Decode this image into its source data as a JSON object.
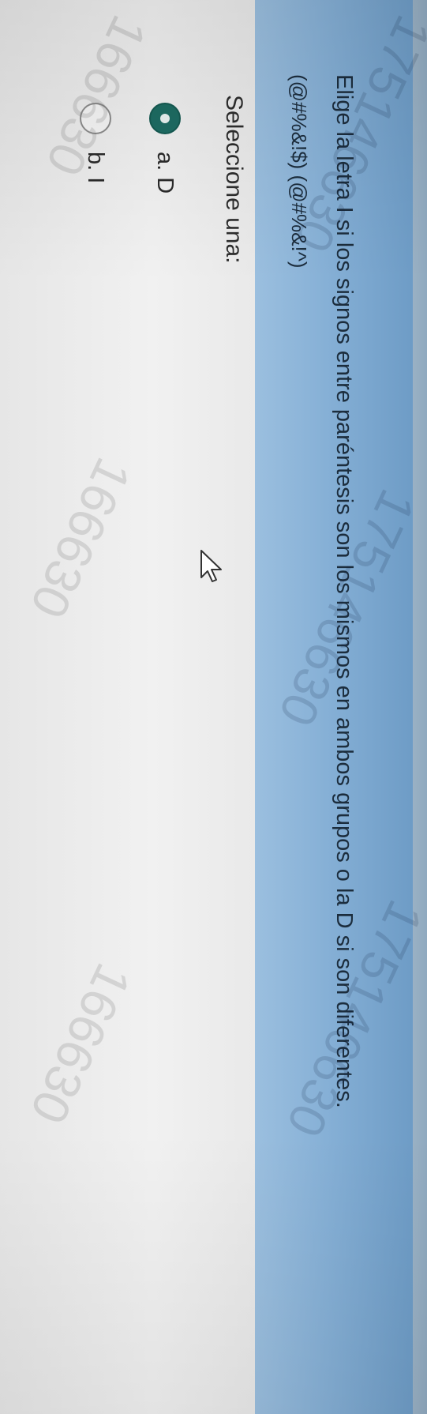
{
  "question": {
    "text": "Elige la letra I si los signos entre paréntesis son los mismos en ambos grupos o la D si son diferentes.",
    "codes": "(@#%&!$) (@#%&!^)"
  },
  "answer": {
    "prompt": "Seleccione una:",
    "options": [
      {
        "label": "a. D",
        "selected": true
      },
      {
        "label": "b. I",
        "selected": false
      }
    ]
  },
  "watermarks": [
    "175146630",
    "175146630",
    "175146630",
    "166630",
    "166630",
    "166630"
  ],
  "icons": {
    "cursor": "mouse-pointer-icon"
  },
  "colors": {
    "question_bg": "#86b0d6",
    "selected_radio": "#1d6c63"
  }
}
